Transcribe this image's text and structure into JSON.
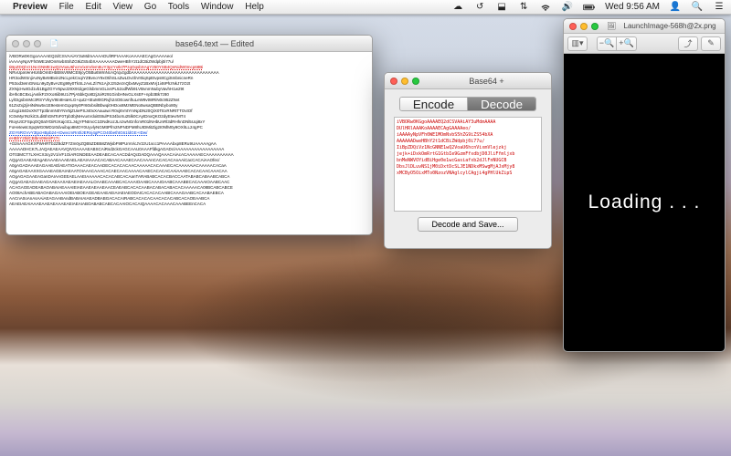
{
  "menubar": {
    "appname": "Preview",
    "items": [
      "File",
      "Edit",
      "View",
      "Go",
      "Tools",
      "Window",
      "Help"
    ],
    "battery_pct": "",
    "day_time": "Wed 9:56 AM"
  },
  "textedit_window": {
    "title": "base64.text — Edited",
    "lines": [
      {
        "cls": "",
        "t": "iVBORw0KGgoAAAAEQ2dCSVAAiAY3uMdmAAAADUlIRFIAAAKoAAAAECAgGAAAAeo/"
      },
      {
        "cls": "",
        "t": "iAAAAyNpVFh0WE1MOmNvbS5hZG9iZS54bXAAAAAAADweHBhY2t1dCBiZWdpbj0i77u/"
      },
      {
        "cls": "red",
        "t": "IiBpZDQiVz1NcGNME1wQ2VoaU6hcnVixmVlem5UY3pzYxIkI7PzqOqsbXAgY250YSB4QnNidW0mcp68Bi"
      },
      {
        "cls": "",
        "t": "NRvUpaVenHU6bOmEHbB8sV8MCE8jcyO5Bu6WmNcAQrqvzgdbAAAAAAAAAAAAAAAAAAAAAAAAAAAAAAAA"
      },
      {
        "cls": "",
        "t": "HR3odWSnjiAxNyBeMBvin2NcLyekCsqiYZBvnoY9xOtihSLsZwLDvzbVI0iqSpEtvps8CgiSmbnicneRn"
      },
      {
        "cls": "",
        "t": "P53od3eInGNsLn9yZyBvAzEg99y0TkSLzAvLZi7N1AjXJz52eznQbxMvyZ1BxMVj1i46PhzNkJ7zO2t"
      },
      {
        "cls": "",
        "t": "ZXNjcHwtGd1vb1BgZGYV6pwJ29X9I1lgeGlsbmmGLivsPL52odfWb91VBvnmNubyVavhH1w29t"
      },
      {
        "cls": "",
        "t": "ibHhcBC8xLjAvIikF2XXo8iib9U1i7PjA5bkQo8t2jJoiRz91GinbHNvGLXsEF+npb3Bk7z80"
      },
      {
        "cls": "",
        "t": "LylGIgsbmMc3RSYVkyV9tn8HaHLG+qut2+tEuM0GRvjh24OEownfIuLeW9vtWRiN0c952ZNvt"
      },
      {
        "cls": "",
        "t": "61ZvZxj2jiHiNiNw5v1E9estemGqxp9y0Pr60xbsilBbwqi0HDox8MzMENo5wsaQBBNbybo80y"
      },
      {
        "cls": "",
        "t": "cZogi184DxXNTTp3bnmN0YNV5jZUiePSJ40xXAauawi R0xj6VntYmNpDN20QiX0TExRNRtTTOvtOf"
      },
      {
        "cls": "",
        "t": "IC0vMyrINzkiCILdiBhGMToF0Tpb3bjNHvusVdoiEt8ulPS34bxXu25lk0CAytDnxQKO2dyEtevrMT4"
      },
      {
        "cls": "",
        "t": "RtoyUtCFSpqOQ0atYDiRzKajctCLJ4gYPNtmcC1DNdKozJLnzwNGnfcmR01lNHbUnRl3dRHhnDNl5Uqi8xY"
      },
      {
        "cls": "",
        "t": "FoHetewtcSpqWG0MD1I0dvuibqo8MOY0UyvlyNGMttPfm2NFNDFM8hUIDMitZig2I0NfM0y9OXlILL24gPC"
      },
      {
        "cls": "blue",
        "t": "ZGY6RGVvY3tpcHBpb24+IDwvcmRn0lJERnj4gPCO40bethtG61ldGE+IDw/"
      },
      {
        "cls": "red",
        "t": "eHBhY2tldCBlbm09inliPz7c"
      },
      {
        "cls": "",
        "t": "+O2nAAAGKXPWHRTb2Z8dZF7Zm0yZQB5ZDB58ZWjsbF9tPUmVicJV2zU1scc1PAAAAbxp8ERu9UAAAAAgAA"
      },
      {
        "cls": "",
        "t": "AAAAADHCK7LJAQAEAEAAVQIVOAAAAEABSCAiRsd2ckGAGCAAU0AAAFfdkgAGADc/AAAAAAAAAAAAAAAAAA"
      },
      {
        "cls": "",
        "t": "OT03MCT7LXHCX3cy2V1iVF1OiARGNDEEAADEABCACAACDdAQcDADQAAAQAAACAiAcACAAAAAECAAAAAAAAAA"
      },
      {
        "cls": "",
        "t": "AQgAGAAEAEAgAEAAAEAAAEAELAEAIAAAACACABAACAAAECAACAAAnCACACACAnAAiCacCACAiAAOfec/"
      },
      {
        "cls": "",
        "t": "A0gAGADAAAEAGAAEAElAEATIOAAACAEACAADECACACACAACAAAAACACAAAECACAAAAAiACAAAAACACaA"
      },
      {
        "cls": "",
        "t": "A0gAGAEAAXXGAAAEAGEAIAEAATOIAAACAAACACAECAACAAAACAAECACACACAAiAAAECACACAACAAACAA"
      },
      {
        "cls": "",
        "t": "AOgAGAGAAEAGanDAIAAGEEAELAAEIAAAAACACACABCACAanTARABABCACACBACCAATABABCABAABCABCA"
      },
      {
        "cls": "",
        "t": "AQgAGAEAGAAEAGAAEAAXAEAEIAEAAALOAABCAAABCACAAAIOAABCAAAIOAABCAAABECACAAAIOAABCAAC"
      },
      {
        "cls": "",
        "t": "ACAGAGEADEABAOABAIAEAAAIEIAEAAEAEAAEAACEAEABCACACAABACABACABACACAAAAACA08BCABCABCE"
      },
      {
        "cls": "",
        "t": "AO08AchABEABAOABAGAAAIOEIABOEAGEAEAAEAEIAIAEIAEODAICACACACAABICAAAGAABCACAABAEBCA"
      },
      {
        "cls": "",
        "t": "AACnA0oAnAsAAiAEAGAABAndBABAIAIAEADBABGACACAIRABCACACACAACACACABCACAOEAABCA"
      },
      {
        "cls": "",
        "t": "AEAEIAEAIAAAEAAEAEAAAEAEIAEAIABOABABCABCACAAIOCACAIQAAAACACAAACAAABEEnCACA"
      }
    ]
  },
  "b64_window": {
    "title": "Base64 +",
    "seg_encode": "Encode",
    "seg_decode": "Decode",
    "textarea_value": "iVBORw0KGgoAAAAEQ2dCSVAAiAY3uMdmAAAA\nDUlHRlAAAKoAAAAECAgGAAAAeo/\niAAAAyNpVFh0WE1MOmNvbS5hZG9iZS54bXA\nAAAAAADweHBhY2t1dCBiZWdpbj0i77u/\nIiBpZDQiVz1NcGNNE1wQ2VoaU6hcnVixmVlejzkj\njejk+iDxkOmRrtG1GtbIe9GzmFfxdbjD0JliFfmljxb\nbnMeNWVOYidBiHge0e1wcGasiafxb2dJlFnNUGCB\nDbsJlDLuvNS1jM0iDxtDcSLJE1NDkxMSwgMjAJxMjy8\nxMCByO5OixMTo0NzozVNAglcylCAgji4gPHlUkZipS",
    "save_btn": "Decode and Save..."
  },
  "preview_window": {
    "title": "LaunchImage-568h@2x.png",
    "image_text": "Loading . . ."
  }
}
